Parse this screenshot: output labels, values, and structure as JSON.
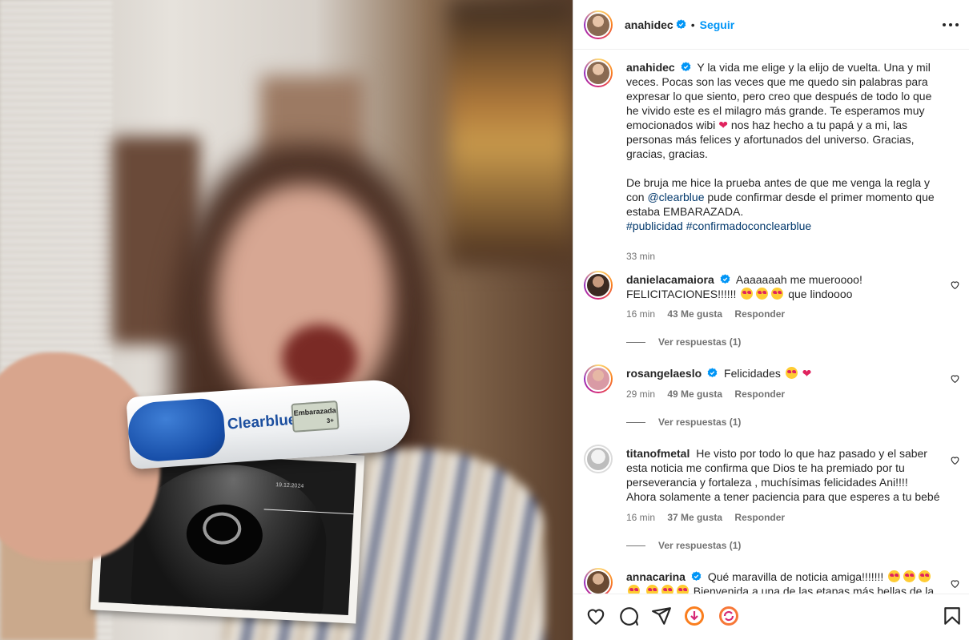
{
  "post": {
    "username": "anahidec",
    "follow_label": "Seguir",
    "separator": "•",
    "caption_p1": "Y la vida me elige y la elijo de vuelta. Una y mil veces. Pocas son las veces que me quedo sin palabras para expresar lo que siento, pero creo que después de todo lo que he vivido este es el milagro más grande. Te esperamos muy emocionados wibi",
    "caption_p1b": "nos haz hecho a tu papá y a mi, las personas más felices y afortunados del universo. Gracias, gracias, gracias.",
    "caption_p2a": "De bruja me hice la prueba antes de que me venga la regla y con",
    "caption_mention": "@clearblue",
    "caption_p2b": "pude confirmar desde el primer momento que estaba EMBARAZADA.",
    "hashtag1": "#publicidad",
    "hashtag2": "#confirmadoconclearblue",
    "time": "33 min"
  },
  "photo": {
    "test_brand": "Clearblue",
    "test_window": "Embarazada",
    "test_weeks": "3+",
    "ultrasound_date": "19.12.2024"
  },
  "comments": [
    {
      "username": "danielacamaiora",
      "text_a": "Aaaaaaah me mueroooo! FELICITACIONES!!!!!!",
      "text_b": "que lindoooo",
      "time": "16 min",
      "likes": "43 Me gusta",
      "reply": "Responder",
      "view_replies": "Ver respuestas (1)"
    },
    {
      "username": "rosangelaeslo",
      "text_a": "Felicidades",
      "time": "29 min",
      "likes": "49 Me gusta",
      "reply": "Responder",
      "view_replies": "Ver respuestas (1)"
    },
    {
      "username": "titanofmetal",
      "text_a": "He visto por todo lo que haz pasado y el saber esta noticia me confirma que Dios te ha premiado por tu perseverancia y fortaleza , muchísimas felicidades Ani!!!! Ahora solamente a tener paciencia para que esperes a tu bebé",
      "time": "16 min",
      "likes": "37 Me gusta",
      "reply": "Responder",
      "view_replies": "Ver respuestas (1)"
    },
    {
      "username": "annacarina",
      "text_a": "Qué maravilla de noticia amiga!!!!!!!",
      "text_b": "Bienvenida a una de las etapas más bellas de la vida!"
    }
  ],
  "icons": [
    "heart-icon",
    "comment-icon",
    "share-icon",
    "gift-icon",
    "refresh-icon",
    "bookmark-icon",
    "more-icon",
    "verified-icon"
  ],
  "colors": {
    "accent": "#0095f6",
    "verified": "#0095f6",
    "text": "#262626",
    "muted": "#737373",
    "heart": "#e0245e"
  }
}
